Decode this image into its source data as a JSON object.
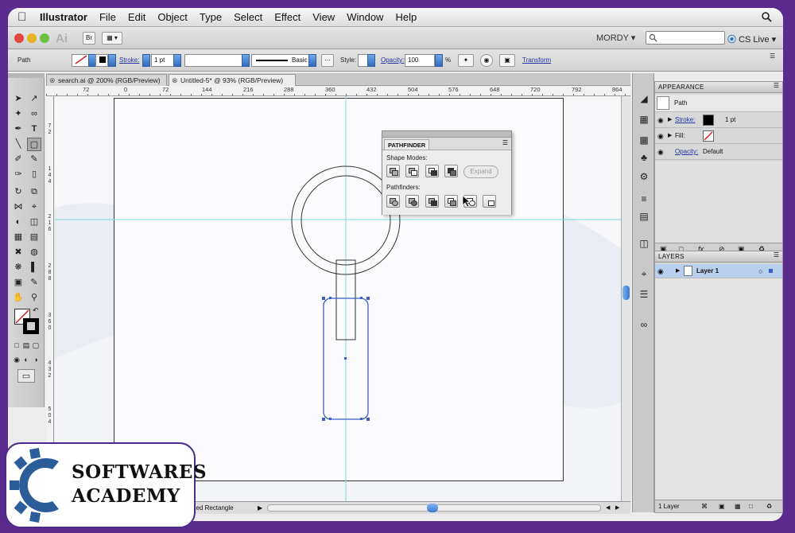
{
  "menubar": {
    "app": "Illustrator",
    "items": [
      "File",
      "Edit",
      "Object",
      "Type",
      "Select",
      "Effect",
      "View",
      "Window",
      "Help"
    ]
  },
  "appbar": {
    "logo": "Ai",
    "bridge": "Br",
    "workspace": "MORDY",
    "cs_live": "CS Live"
  },
  "control": {
    "selection": "Path",
    "stroke_label": "Stroke:",
    "stroke_value": "1 pt",
    "profile": "Basic",
    "style_label": "Style:",
    "opacity_label": "Opacity:",
    "opacity_value": "100",
    "opacity_unit": "%",
    "transform": "Transform"
  },
  "tabs": [
    {
      "label": "search.ai @ 200% (RGB/Preview)",
      "active": false
    },
    {
      "label": "Untitled-5* @ 93% (RGB/Preview)",
      "active": true
    }
  ],
  "hruler": [
    "72",
    "0",
    "72",
    "144",
    "216",
    "288",
    "360",
    "432",
    "504",
    "576",
    "648",
    "720",
    "792",
    "864"
  ],
  "vruler": [
    "7\n2",
    "1\n4\n4",
    "2\n1\n6",
    "2\n8\n8",
    "3\n6\n0",
    "4\n3\n2",
    "5\n0\n4"
  ],
  "pathfinder": {
    "title": "PATHFINDER",
    "shape_modes": "Shape Modes:",
    "expand": "Expand",
    "pathfinders": "Pathfinders:"
  },
  "appearance": {
    "title": "APPEARANCE",
    "object": "Path",
    "stroke_label": "Stroke:",
    "stroke_value": "1 pt",
    "fill_label": "Fill:",
    "opacity_label": "Opacity:",
    "opacity_value": "Default"
  },
  "layers": {
    "title": "LAYERS",
    "layer": "Layer 1",
    "count": "1 Layer"
  },
  "status": {
    "text": "ded Rectangle"
  },
  "watermark": {
    "line1": "SOFTWARES",
    "line2": "ACADEMY"
  },
  "colors": {
    "guide": "#7fd8d8",
    "selection": "#3a5fc4",
    "accent_frame": "#5b2a8e"
  }
}
